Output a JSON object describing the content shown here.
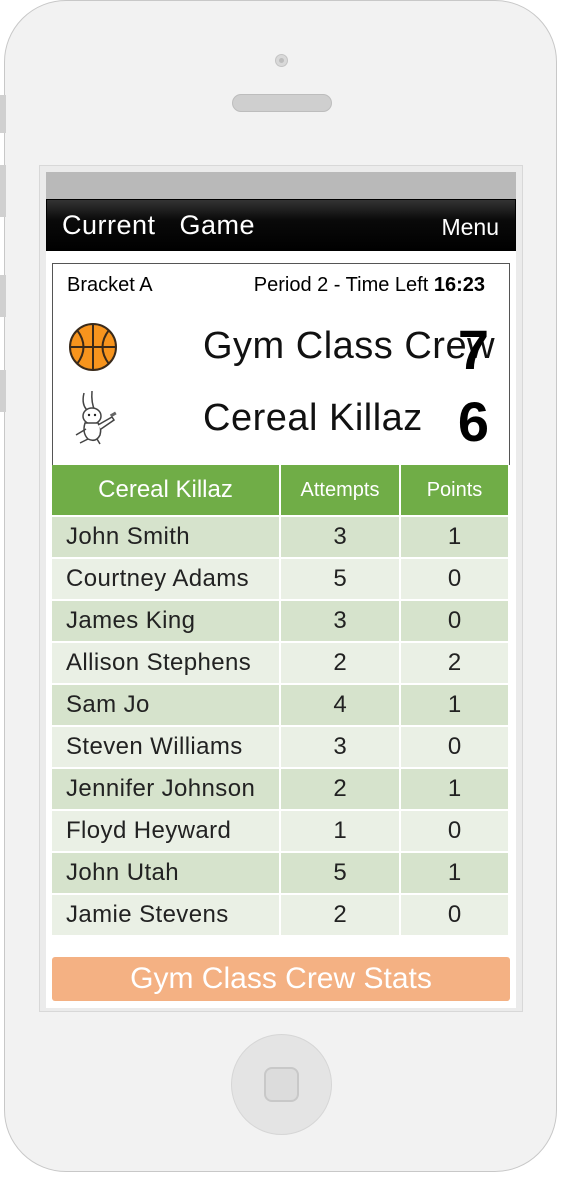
{
  "app": {
    "title": "Current  Game",
    "menu_label": "Menu"
  },
  "game": {
    "bracket": "Bracket A",
    "period_text": "Period 2 - Time Left",
    "time_left": "16:23"
  },
  "teams": [
    {
      "name": "Gym Class Crew",
      "score": "7",
      "icon": "basketball-icon"
    },
    {
      "name": "Cereal Killaz",
      "score": "6",
      "icon": "rabbit-mascot-icon"
    }
  ],
  "stats_table": {
    "team_header": "Cereal Killaz",
    "attempts_header": "Attempts",
    "points_header": "Points",
    "rows": [
      {
        "name": "John Smith",
        "attempts": "3",
        "points": "1"
      },
      {
        "name": "Courtney Adams",
        "attempts": "5",
        "points": "0"
      },
      {
        "name": "James King",
        "attempts": "3",
        "points": "0"
      },
      {
        "name": "Allison Stephens",
        "attempts": "2",
        "points": "2"
      },
      {
        "name": "Sam Jo",
        "attempts": "4",
        "points": "1"
      },
      {
        "name": "Steven Williams",
        "attempts": "3",
        "points": "0"
      },
      {
        "name": "Jennifer Johnson",
        "attempts": "2",
        "points": "1"
      },
      {
        "name": "Floyd Heyward",
        "attempts": "1",
        "points": "0"
      },
      {
        "name": "John Utah",
        "attempts": "5",
        "points": "1"
      },
      {
        "name": "Jamie Stevens",
        "attempts": "2",
        "points": "0"
      }
    ]
  },
  "other_team_button": "Gym Class Crew Stats",
  "colors": {
    "header_green": "#70ad47",
    "row_green": "#d6e3cc",
    "row_light": "#eaf0e5",
    "button_orange": "#f4b183"
  }
}
